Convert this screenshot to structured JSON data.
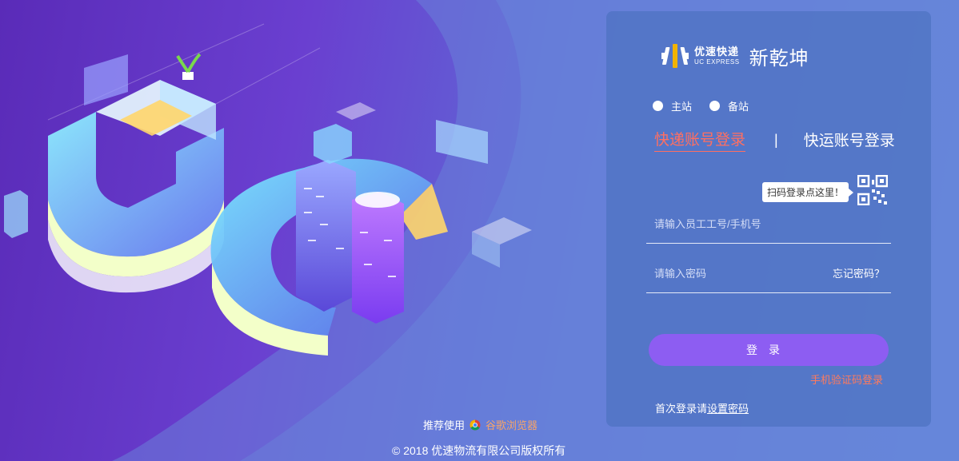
{
  "brand": {
    "logo_cn": "优速快递",
    "logo_en": "UC EXPRESS",
    "app_name": "新乾坤",
    "logo_color": "#f2b300"
  },
  "site_options": [
    {
      "label": "主站",
      "selected": false
    },
    {
      "label": "备站",
      "selected": false
    }
  ],
  "tabs": {
    "active": "快递账号登录",
    "separator": "|",
    "inactive": "快运账号登录"
  },
  "qr": {
    "tooltip": "扫码登录点这里！",
    "icon": "qr-code-icon"
  },
  "form": {
    "username_placeholder": "请输入员工工号/手机号",
    "password_placeholder": "请输入密码",
    "forgot_label": "忘记密码？",
    "login_label": "登录",
    "sms_login_label": "手机验证码登录",
    "first_login_prefix": "首次登录请",
    "set_password_label": "设置密码"
  },
  "footer": {
    "recommend_label": "推荐使用",
    "browser_icon": "chrome-icon",
    "browser_label": "谷歌浏览器",
    "copyright": "© 2018 优速物流有限公司版权所有"
  },
  "colors": {
    "active_tab": "#ff6f61",
    "login_button": "#8d5df2",
    "sms_link": "#ff7a5c",
    "browser_link": "#f5a46a"
  }
}
